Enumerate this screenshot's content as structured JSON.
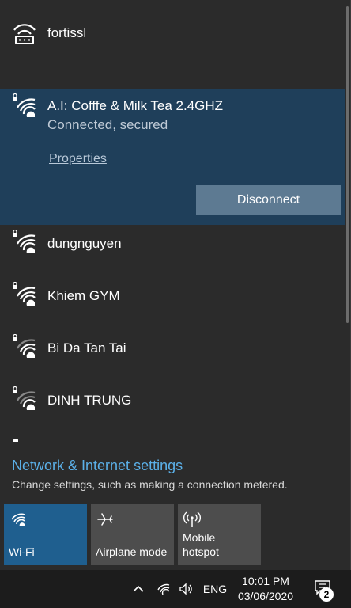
{
  "networks": {
    "top": {
      "name": "fortissl",
      "icon": "vpn-icon"
    },
    "connected": {
      "name": "A.I: Cofffe & Milk Tea 2.4GHZ",
      "status": "Connected, secured",
      "properties_label": "Properties",
      "disconnect_label": "Disconnect",
      "icon": "wifi-secured-icon"
    },
    "list": [
      {
        "name": "dungnguyen",
        "icon": "wifi-secured-icon"
      },
      {
        "name": "Khiem GYM",
        "icon": "wifi-secured-icon"
      },
      {
        "name": "Bi Da Tan Tai",
        "icon": "wifi-secured-weak-icon"
      },
      {
        "name": "DINH TRUNG",
        "icon": "wifi-secured-weak-icon"
      }
    ]
  },
  "settings": {
    "link_label": "Network & Internet settings",
    "description": "Change settings, such as making a connection metered."
  },
  "quick_actions": [
    {
      "label": "Wi-Fi",
      "icon": "wifi-icon",
      "active": true
    },
    {
      "label": "Airplane mode",
      "icon": "airplane-icon",
      "active": false
    },
    {
      "label": "Mobile hotspot",
      "icon": "hotspot-icon",
      "active": false
    }
  ],
  "taskbar": {
    "language": "ENG",
    "time": "10:01 PM",
    "date": "03/06/2020",
    "notification_count": "2"
  },
  "colors": {
    "accent": "#1f5f8f",
    "link": "#5bb0e8",
    "connected_bg": "#1f3f5a"
  }
}
